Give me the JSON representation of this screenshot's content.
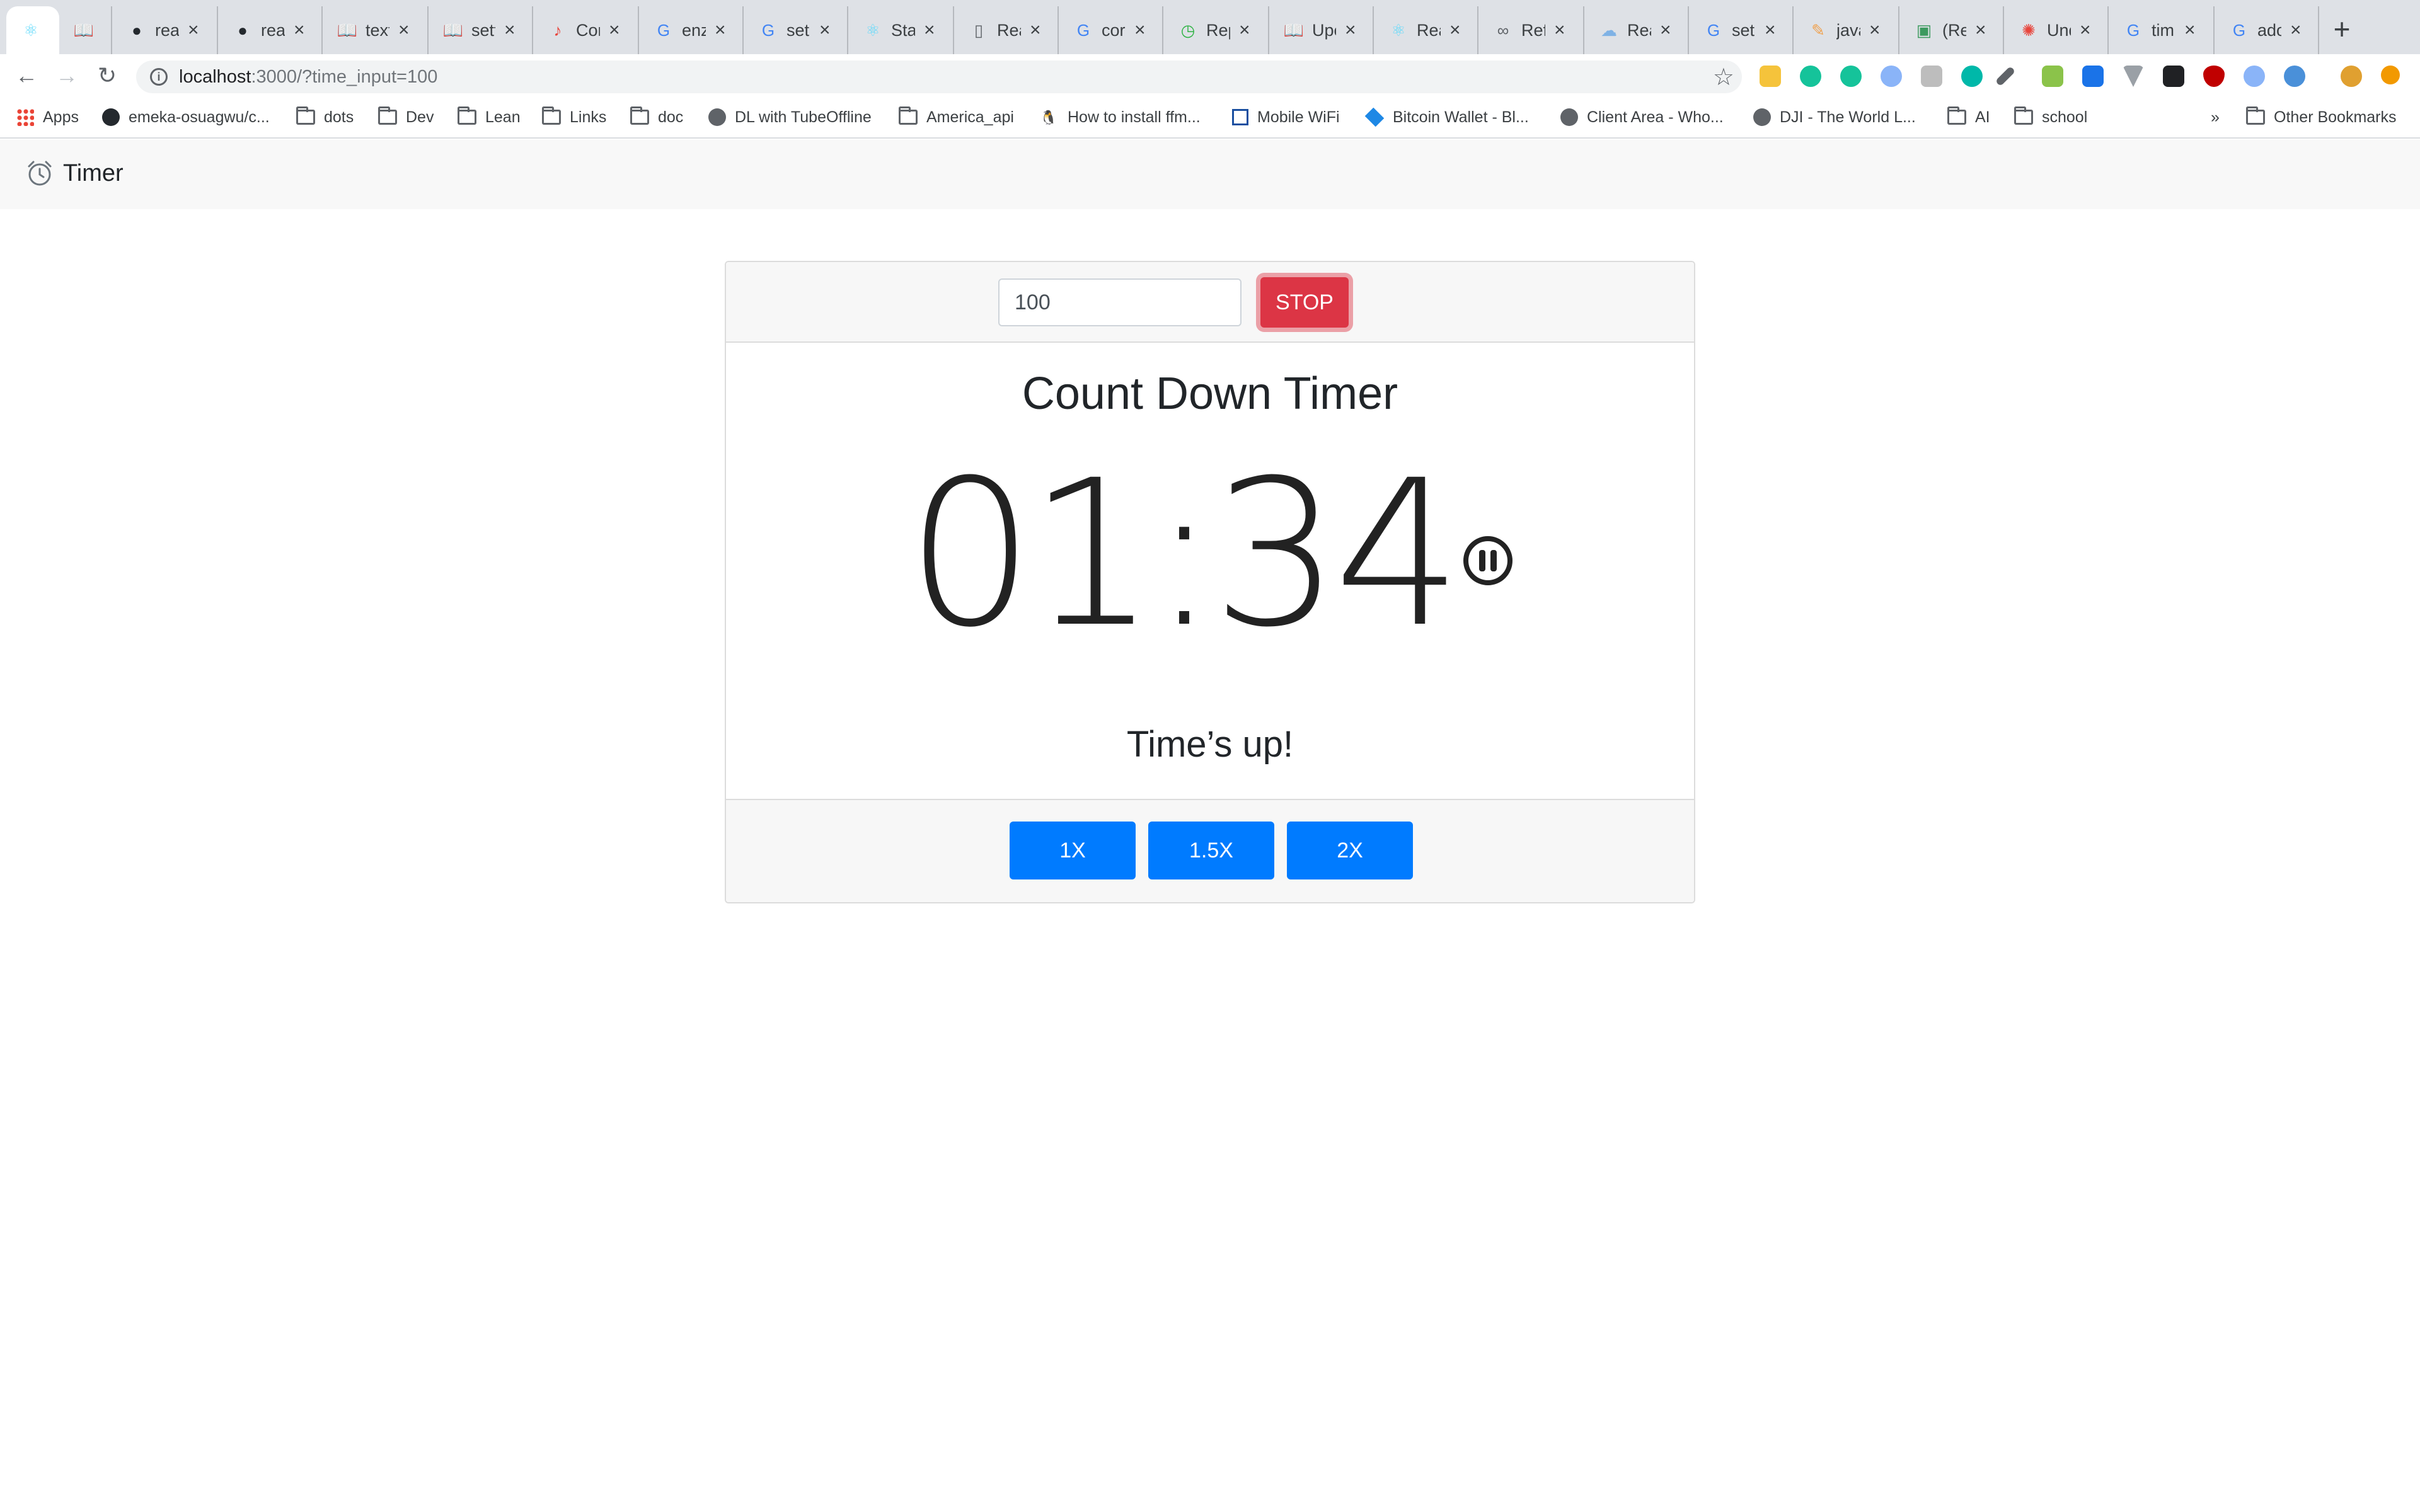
{
  "browser": {
    "tabs": [
      {
        "title": "",
        "icon": "react-icon",
        "color": "#61dafb"
      },
      {
        "title": "",
        "icon": "book-icon",
        "color": "#5f6368"
      },
      {
        "title": "rea",
        "icon": "github-icon",
        "color": "#24292e"
      },
      {
        "title": "rea",
        "icon": "github-icon",
        "color": "#24292e"
      },
      {
        "title": "text",
        "icon": "book-icon",
        "color": "#5f6368"
      },
      {
        "title": "sett",
        "icon": "book-icon",
        "color": "#5f6368"
      },
      {
        "title": "Cor",
        "icon": "music-note-icon",
        "color": "#e8453c"
      },
      {
        "title": "enz",
        "icon": "google-icon",
        "color": "#4285f4"
      },
      {
        "title": "set",
        "icon": "google-icon",
        "color": "#4285f4"
      },
      {
        "title": "Sta",
        "icon": "react-icon",
        "color": "#61dafb"
      },
      {
        "title": "Rea",
        "icon": "document-icon",
        "color": "#5f6368"
      },
      {
        "title": "cor",
        "icon": "google-icon",
        "color": "#4285f4"
      },
      {
        "title": "Rep",
        "icon": "timer-icon",
        "color": "#2fb344"
      },
      {
        "title": "Upc",
        "icon": "book-icon",
        "color": "#5f6368"
      },
      {
        "title": "Rea",
        "icon": "react-icon",
        "color": "#61dafb"
      },
      {
        "title": "Ref",
        "icon": "glasses-icon",
        "color": "#5f6368"
      },
      {
        "title": "Rea",
        "icon": "cloud-icon",
        "color": "#7fb2e5"
      },
      {
        "title": "set",
        "icon": "google-icon",
        "color": "#4285f4"
      },
      {
        "title": "java",
        "icon": "pen-icon",
        "color": "#f0a04b"
      },
      {
        "title": "(Re",
        "icon": "image-icon",
        "color": "#3c9a5f"
      },
      {
        "title": "Und",
        "icon": "asterisk-icon",
        "color": "#e8453c"
      },
      {
        "title": "tim",
        "icon": "google-icon",
        "color": "#4285f4"
      },
      {
        "title": "ado",
        "icon": "google-icon",
        "color": "#4285f4"
      }
    ],
    "url_host": "localhost",
    "url_path": ":3000/?time_input=100",
    "bookmarks": [
      {
        "label": "Apps",
        "icon": "apps-icon"
      },
      {
        "label": "emeka-osuagwu/c...",
        "icon": "github-icon"
      },
      {
        "label": "dots",
        "icon": "folder-icon"
      },
      {
        "label": "Dev",
        "icon": "folder-icon"
      },
      {
        "label": "Lean",
        "icon": "folder-icon"
      },
      {
        "label": "Links",
        "icon": "folder-icon"
      },
      {
        "label": "doc",
        "icon": "folder-icon"
      },
      {
        "label": "DL with TubeOffline",
        "icon": "globe-icon"
      },
      {
        "label": "America_api",
        "icon": "folder-icon"
      },
      {
        "label": "How to install ffm...",
        "icon": "linux-icon"
      },
      {
        "label": "Mobile WiFi",
        "icon": "router-icon"
      },
      {
        "label": "Bitcoin Wallet - Bl...",
        "icon": "blockchain-icon"
      },
      {
        "label": "Client Area - Who...",
        "icon": "whois-icon"
      },
      {
        "label": "DJI - The World L...",
        "icon": "globe-icon"
      },
      {
        "label": "AI",
        "icon": "folder-icon"
      },
      {
        "label": "school",
        "icon": "folder-icon"
      }
    ],
    "bookmarks_overflow": "»",
    "other_bookmarks": "Other Bookmarks"
  },
  "app": {
    "brand": "Timer",
    "input_value": "100",
    "stop_label": "STOP",
    "heading": "Count Down Timer",
    "time": "01:34",
    "status": "Time’s up!",
    "speeds": [
      "1X",
      "1.5X",
      "2X"
    ]
  },
  "colors": {
    "danger": "#dc3545",
    "primary": "#007bff",
    "card_header_bg": "#f7f7f7",
    "navbar_bg": "#f8f8f8"
  }
}
